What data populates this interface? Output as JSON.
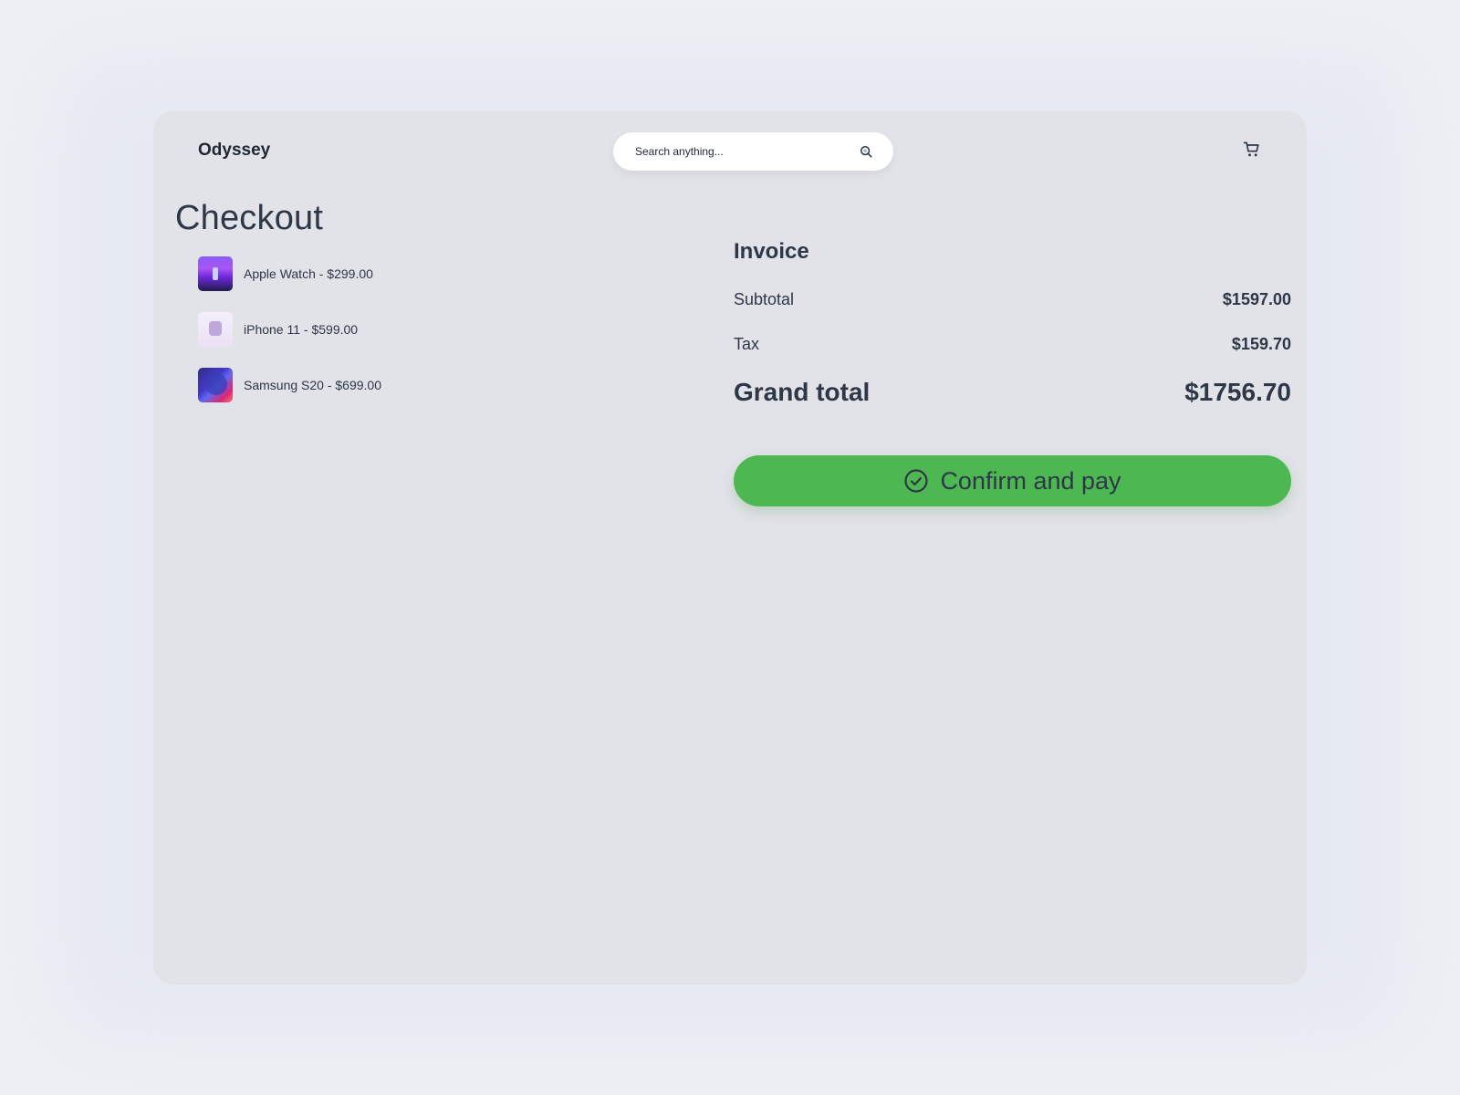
{
  "header": {
    "brand": "Odyssey",
    "search": {
      "placeholder": "Search anything..."
    }
  },
  "page": {
    "title": "Checkout"
  },
  "cart_items": [
    {
      "label": "Apple Watch - $299.00"
    },
    {
      "label": "iPhone 11 - $599.00"
    },
    {
      "label": "Samsung S20 - $699.00"
    }
  ],
  "invoice": {
    "title": "Invoice",
    "subtotal_label": "Subtotal",
    "subtotal_value": "$1597.00",
    "tax_label": "Tax",
    "tax_value": "$159.70",
    "grand_label": "Grand total",
    "grand_value": "$1756.70"
  },
  "actions": {
    "pay_label": "Confirm and pay"
  },
  "colors": {
    "accent": "#4db852",
    "card_bg": "#e2e3e8",
    "text": "#2d3748"
  },
  "icons": [
    "search-icon",
    "cart-icon",
    "check-circle-icon"
  ]
}
